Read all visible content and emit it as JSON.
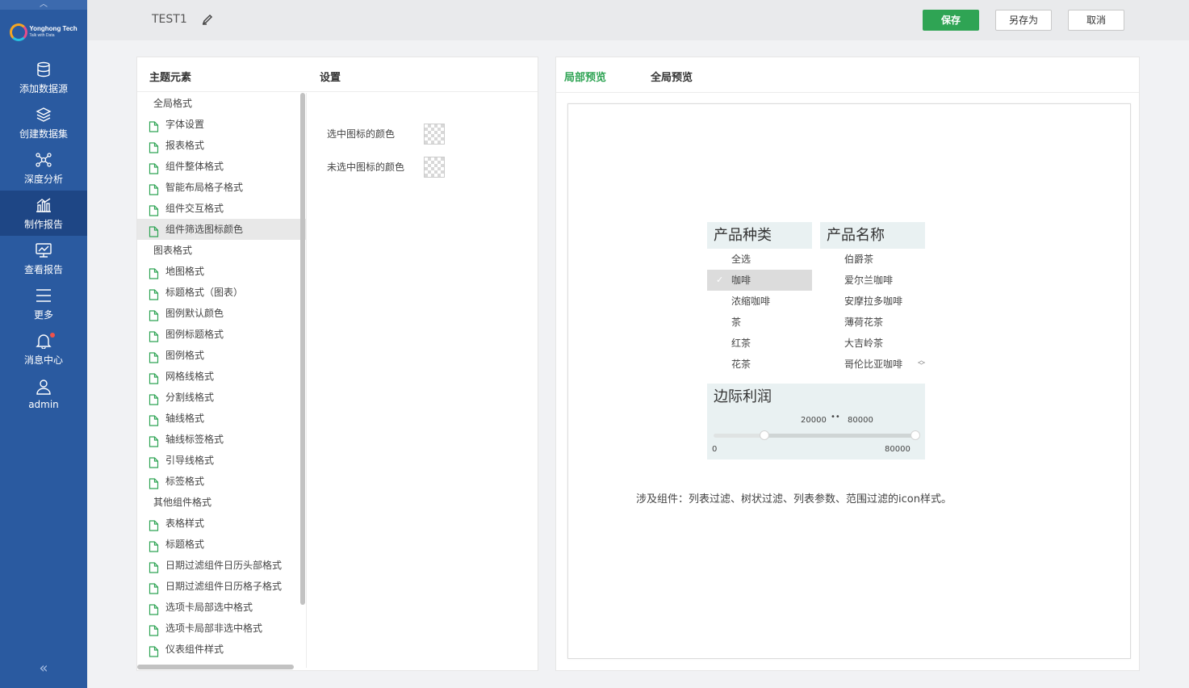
{
  "sidebar": {
    "logo": {
      "brand": "Yonghong Tech",
      "slogan": "Talk with Data"
    },
    "items": [
      {
        "label": "添加数据源",
        "icon": "database-icon"
      },
      {
        "label": "创建数据集",
        "icon": "layers-icon"
      },
      {
        "label": "深度分析",
        "icon": "network-icon"
      },
      {
        "label": "制作报告",
        "icon": "chart-bar-icon",
        "active": true
      },
      {
        "label": "查看报告",
        "icon": "monitor-chart-icon"
      },
      {
        "label": "更多",
        "icon": "menu-icon"
      },
      {
        "label": "消息中心",
        "icon": "bell-icon"
      },
      {
        "label": "admin",
        "icon": "user-icon"
      }
    ],
    "collapse_glyph": "«"
  },
  "topbar": {
    "title": "TEST1",
    "save": "保存",
    "save_as": "另存为",
    "cancel": "取消"
  },
  "left_panel": {
    "heading_elements": "主题元素",
    "heading_settings": "设置",
    "rows": [
      {
        "type": "group",
        "label": "全局格式"
      },
      {
        "type": "item",
        "label": "字体设置"
      },
      {
        "type": "item",
        "label": "报表格式"
      },
      {
        "type": "item",
        "label": "组件整体格式"
      },
      {
        "type": "item",
        "label": "智能布局格子格式"
      },
      {
        "type": "item",
        "label": "组件交互格式"
      },
      {
        "type": "item",
        "label": "组件筛选图标颜色",
        "selected": true
      },
      {
        "type": "group",
        "label": "图表格式"
      },
      {
        "type": "item",
        "label": "地图格式"
      },
      {
        "type": "item",
        "label": "标题格式（图表）"
      },
      {
        "type": "item",
        "label": "图例默认颜色"
      },
      {
        "type": "item",
        "label": "图例标题格式"
      },
      {
        "type": "item",
        "label": "图例格式"
      },
      {
        "type": "item",
        "label": "网格线格式"
      },
      {
        "type": "item",
        "label": "分割线格式"
      },
      {
        "type": "item",
        "label": "轴线格式"
      },
      {
        "type": "item",
        "label": "轴线标签格式"
      },
      {
        "type": "item",
        "label": "引导线格式"
      },
      {
        "type": "item",
        "label": "标签格式"
      },
      {
        "type": "group",
        "label": "其他组件格式"
      },
      {
        "type": "item",
        "label": "表格样式"
      },
      {
        "type": "item",
        "label": "标题格式"
      },
      {
        "type": "item",
        "label": "日期过滤组件日历头部格式"
      },
      {
        "type": "item",
        "label": "日期过滤组件日历格子格式"
      },
      {
        "type": "item",
        "label": "选项卡局部选中格式"
      },
      {
        "type": "item",
        "label": "选项卡局部非选中格式"
      },
      {
        "type": "item",
        "label": "仪表组件样式"
      }
    ],
    "settings": {
      "selected_icon_color_label": "选中图标的颜色",
      "unselected_icon_color_label": "未选中图标的颜色"
    }
  },
  "right_panel": {
    "tab_local": "局部预览",
    "tab_global": "全局预览",
    "filter_category": {
      "title": "产品种类",
      "options": [
        "全选",
        "咖啡",
        "浓缩咖啡",
        "茶",
        "红茶",
        "花茶"
      ],
      "checked_index": 1
    },
    "filter_name": {
      "title": "产品名称",
      "options": [
        "伯爵茶",
        "爱尔兰咖啡",
        "安摩拉多咖啡",
        "薄荷花茶",
        "大吉岭茶",
        "哥伦比亚咖啡"
      ]
    },
    "range": {
      "title": "边际利润",
      "low_value": "20000",
      "high_value": "80000",
      "min": "0",
      "max": "80000",
      "low_fraction": 0.25,
      "high_fraction": 1.0
    },
    "note": "涉及组件：列表过滤、树状过滤、列表参数、范围过滤的icon样式。"
  },
  "colors": {
    "sidebar_bg": "#2a5aa0",
    "accent_green": "#2fa454"
  }
}
